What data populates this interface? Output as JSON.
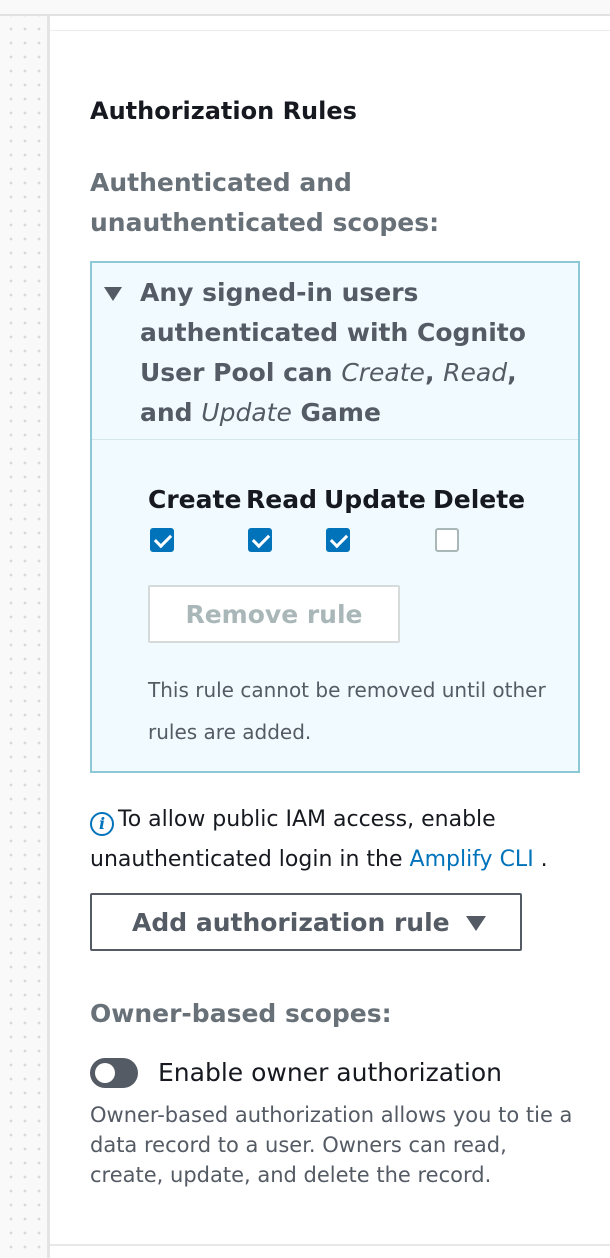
{
  "auth": {
    "title": "Authorization Rules",
    "scopes_label": "Authenticated and unauthenticated scopes:",
    "rule": {
      "title_parts": {
        "intro": "Any signed-in users authenticated with Cognito User Pool can ",
        "create": "Create",
        "comma": ", ",
        "read": "Read",
        "and": ", and ",
        "update": "Update",
        "target": " Game"
      },
      "permissions": [
        {
          "label": "Create",
          "checked": true
        },
        {
          "label": "Read",
          "checked": true
        },
        {
          "label": "Update",
          "checked": true
        },
        {
          "label": "Delete",
          "checked": false
        }
      ],
      "remove_button": "Remove rule",
      "note": "This rule cannot be removed until other rules are added."
    },
    "info": {
      "icon": "info-icon",
      "text": "To allow public IAM access, enable unauthenticated login in the ",
      "link": "Amplify CLI",
      "suffix": " ."
    },
    "add_rule_button": "Add authorization rule",
    "owner": {
      "label": "Owner-based scopes:",
      "toggle_label": "Enable owner authorization",
      "toggle_on": false,
      "description": "Owner-based authorization allows you to tie a data record to a user. Owners can read, create, update, and delete the record."
    }
  },
  "colors": {
    "accent": "#0073bb",
    "card_border": "#8cc8d6",
    "card_background": "#f1faff",
    "muted_label": "#687078"
  }
}
